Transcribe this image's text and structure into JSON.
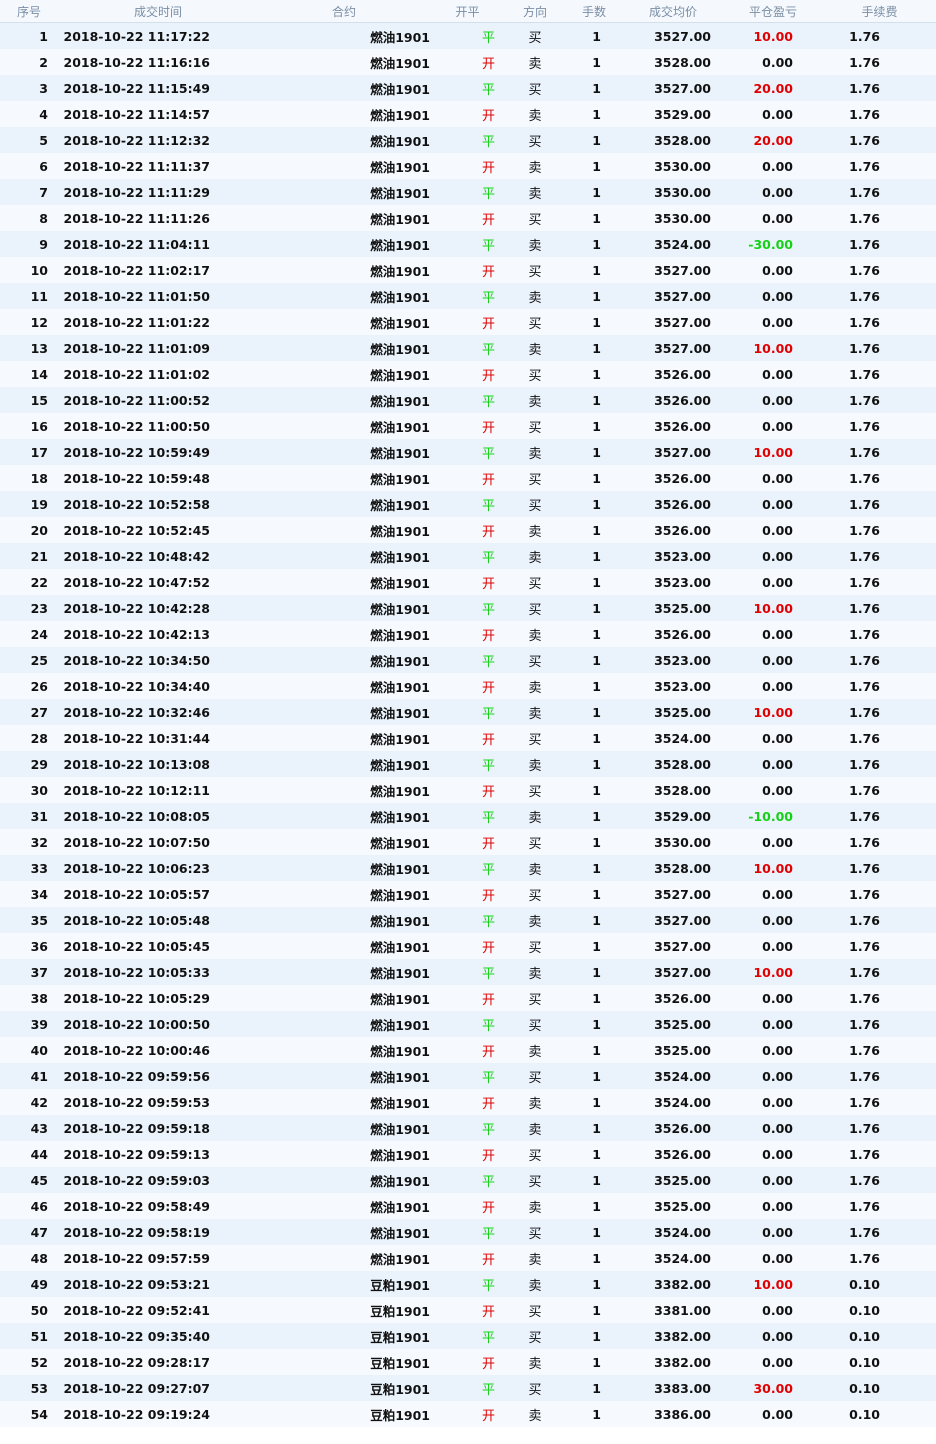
{
  "table": {
    "headers": [
      "序号",
      "成交时间",
      "合约",
      "开平",
      "方向",
      "手数",
      "成交均价",
      "平仓盈亏",
      "手续费"
    ],
    "colors": {
      "open": "#e00000",
      "close": "#16d016",
      "profit": "#e00000",
      "loss": "#16d016"
    },
    "rows": [
      {
        "no": "1",
        "time": "2018-10-22 11:17:22",
        "contract": "燃油1901",
        "oc": "平",
        "dir": "买",
        "lots": "1",
        "price": "3527.00",
        "pnl": "10.00",
        "fee": "1.76"
      },
      {
        "no": "2",
        "time": "2018-10-22 11:16:16",
        "contract": "燃油1901",
        "oc": "开",
        "dir": "卖",
        "lots": "1",
        "price": "3528.00",
        "pnl": "0.00",
        "fee": "1.76"
      },
      {
        "no": "3",
        "time": "2018-10-22 11:15:49",
        "contract": "燃油1901",
        "oc": "平",
        "dir": "买",
        "lots": "1",
        "price": "3527.00",
        "pnl": "20.00",
        "fee": "1.76"
      },
      {
        "no": "4",
        "time": "2018-10-22 11:14:57",
        "contract": "燃油1901",
        "oc": "开",
        "dir": "卖",
        "lots": "1",
        "price": "3529.00",
        "pnl": "0.00",
        "fee": "1.76"
      },
      {
        "no": "5",
        "time": "2018-10-22 11:12:32",
        "contract": "燃油1901",
        "oc": "平",
        "dir": "买",
        "lots": "1",
        "price": "3528.00",
        "pnl": "20.00",
        "fee": "1.76"
      },
      {
        "no": "6",
        "time": "2018-10-22 11:11:37",
        "contract": "燃油1901",
        "oc": "开",
        "dir": "卖",
        "lots": "1",
        "price": "3530.00",
        "pnl": "0.00",
        "fee": "1.76"
      },
      {
        "no": "7",
        "time": "2018-10-22 11:11:29",
        "contract": "燃油1901",
        "oc": "平",
        "dir": "卖",
        "lots": "1",
        "price": "3530.00",
        "pnl": "0.00",
        "fee": "1.76"
      },
      {
        "no": "8",
        "time": "2018-10-22 11:11:26",
        "contract": "燃油1901",
        "oc": "开",
        "dir": "买",
        "lots": "1",
        "price": "3530.00",
        "pnl": "0.00",
        "fee": "1.76"
      },
      {
        "no": "9",
        "time": "2018-10-22 11:04:11",
        "contract": "燃油1901",
        "oc": "平",
        "dir": "卖",
        "lots": "1",
        "price": "3524.00",
        "pnl": "-30.00",
        "fee": "1.76"
      },
      {
        "no": "10",
        "time": "2018-10-22 11:02:17",
        "contract": "燃油1901",
        "oc": "开",
        "dir": "买",
        "lots": "1",
        "price": "3527.00",
        "pnl": "0.00",
        "fee": "1.76"
      },
      {
        "no": "11",
        "time": "2018-10-22 11:01:50",
        "contract": "燃油1901",
        "oc": "平",
        "dir": "卖",
        "lots": "1",
        "price": "3527.00",
        "pnl": "0.00",
        "fee": "1.76"
      },
      {
        "no": "12",
        "time": "2018-10-22 11:01:22",
        "contract": "燃油1901",
        "oc": "开",
        "dir": "买",
        "lots": "1",
        "price": "3527.00",
        "pnl": "0.00",
        "fee": "1.76"
      },
      {
        "no": "13",
        "time": "2018-10-22 11:01:09",
        "contract": "燃油1901",
        "oc": "平",
        "dir": "卖",
        "lots": "1",
        "price": "3527.00",
        "pnl": "10.00",
        "fee": "1.76"
      },
      {
        "no": "14",
        "time": "2018-10-22 11:01:02",
        "contract": "燃油1901",
        "oc": "开",
        "dir": "买",
        "lots": "1",
        "price": "3526.00",
        "pnl": "0.00",
        "fee": "1.76"
      },
      {
        "no": "15",
        "time": "2018-10-22 11:00:52",
        "contract": "燃油1901",
        "oc": "平",
        "dir": "卖",
        "lots": "1",
        "price": "3526.00",
        "pnl": "0.00",
        "fee": "1.76"
      },
      {
        "no": "16",
        "time": "2018-10-22 11:00:50",
        "contract": "燃油1901",
        "oc": "开",
        "dir": "买",
        "lots": "1",
        "price": "3526.00",
        "pnl": "0.00",
        "fee": "1.76"
      },
      {
        "no": "17",
        "time": "2018-10-22 10:59:49",
        "contract": "燃油1901",
        "oc": "平",
        "dir": "卖",
        "lots": "1",
        "price": "3527.00",
        "pnl": "10.00",
        "fee": "1.76"
      },
      {
        "no": "18",
        "time": "2018-10-22 10:59:48",
        "contract": "燃油1901",
        "oc": "开",
        "dir": "买",
        "lots": "1",
        "price": "3526.00",
        "pnl": "0.00",
        "fee": "1.76"
      },
      {
        "no": "19",
        "time": "2018-10-22 10:52:58",
        "contract": "燃油1901",
        "oc": "平",
        "dir": "买",
        "lots": "1",
        "price": "3526.00",
        "pnl": "0.00",
        "fee": "1.76"
      },
      {
        "no": "20",
        "time": "2018-10-22 10:52:45",
        "contract": "燃油1901",
        "oc": "开",
        "dir": "卖",
        "lots": "1",
        "price": "3526.00",
        "pnl": "0.00",
        "fee": "1.76"
      },
      {
        "no": "21",
        "time": "2018-10-22 10:48:42",
        "contract": "燃油1901",
        "oc": "平",
        "dir": "卖",
        "lots": "1",
        "price": "3523.00",
        "pnl": "0.00",
        "fee": "1.76"
      },
      {
        "no": "22",
        "time": "2018-10-22 10:47:52",
        "contract": "燃油1901",
        "oc": "开",
        "dir": "买",
        "lots": "1",
        "price": "3523.00",
        "pnl": "0.00",
        "fee": "1.76"
      },
      {
        "no": "23",
        "time": "2018-10-22 10:42:28",
        "contract": "燃油1901",
        "oc": "平",
        "dir": "买",
        "lots": "1",
        "price": "3525.00",
        "pnl": "10.00",
        "fee": "1.76"
      },
      {
        "no": "24",
        "time": "2018-10-22 10:42:13",
        "contract": "燃油1901",
        "oc": "开",
        "dir": "卖",
        "lots": "1",
        "price": "3526.00",
        "pnl": "0.00",
        "fee": "1.76"
      },
      {
        "no": "25",
        "time": "2018-10-22 10:34:50",
        "contract": "燃油1901",
        "oc": "平",
        "dir": "买",
        "lots": "1",
        "price": "3523.00",
        "pnl": "0.00",
        "fee": "1.76"
      },
      {
        "no": "26",
        "time": "2018-10-22 10:34:40",
        "contract": "燃油1901",
        "oc": "开",
        "dir": "卖",
        "lots": "1",
        "price": "3523.00",
        "pnl": "0.00",
        "fee": "1.76"
      },
      {
        "no": "27",
        "time": "2018-10-22 10:32:46",
        "contract": "燃油1901",
        "oc": "平",
        "dir": "卖",
        "lots": "1",
        "price": "3525.00",
        "pnl": "10.00",
        "fee": "1.76"
      },
      {
        "no": "28",
        "time": "2018-10-22 10:31:44",
        "contract": "燃油1901",
        "oc": "开",
        "dir": "买",
        "lots": "1",
        "price": "3524.00",
        "pnl": "0.00",
        "fee": "1.76"
      },
      {
        "no": "29",
        "time": "2018-10-22 10:13:08",
        "contract": "燃油1901",
        "oc": "平",
        "dir": "卖",
        "lots": "1",
        "price": "3528.00",
        "pnl": "0.00",
        "fee": "1.76"
      },
      {
        "no": "30",
        "time": "2018-10-22 10:12:11",
        "contract": "燃油1901",
        "oc": "开",
        "dir": "买",
        "lots": "1",
        "price": "3528.00",
        "pnl": "0.00",
        "fee": "1.76"
      },
      {
        "no": "31",
        "time": "2018-10-22 10:08:05",
        "contract": "燃油1901",
        "oc": "平",
        "dir": "卖",
        "lots": "1",
        "price": "3529.00",
        "pnl": "-10.00",
        "fee": "1.76"
      },
      {
        "no": "32",
        "time": "2018-10-22 10:07:50",
        "contract": "燃油1901",
        "oc": "开",
        "dir": "买",
        "lots": "1",
        "price": "3530.00",
        "pnl": "0.00",
        "fee": "1.76"
      },
      {
        "no": "33",
        "time": "2018-10-22 10:06:23",
        "contract": "燃油1901",
        "oc": "平",
        "dir": "卖",
        "lots": "1",
        "price": "3528.00",
        "pnl": "10.00",
        "fee": "1.76"
      },
      {
        "no": "34",
        "time": "2018-10-22 10:05:57",
        "contract": "燃油1901",
        "oc": "开",
        "dir": "买",
        "lots": "1",
        "price": "3527.00",
        "pnl": "0.00",
        "fee": "1.76"
      },
      {
        "no": "35",
        "time": "2018-10-22 10:05:48",
        "contract": "燃油1901",
        "oc": "平",
        "dir": "卖",
        "lots": "1",
        "price": "3527.00",
        "pnl": "0.00",
        "fee": "1.76"
      },
      {
        "no": "36",
        "time": "2018-10-22 10:05:45",
        "contract": "燃油1901",
        "oc": "开",
        "dir": "买",
        "lots": "1",
        "price": "3527.00",
        "pnl": "0.00",
        "fee": "1.76"
      },
      {
        "no": "37",
        "time": "2018-10-22 10:05:33",
        "contract": "燃油1901",
        "oc": "平",
        "dir": "卖",
        "lots": "1",
        "price": "3527.00",
        "pnl": "10.00",
        "fee": "1.76"
      },
      {
        "no": "38",
        "time": "2018-10-22 10:05:29",
        "contract": "燃油1901",
        "oc": "开",
        "dir": "买",
        "lots": "1",
        "price": "3526.00",
        "pnl": "0.00",
        "fee": "1.76"
      },
      {
        "no": "39",
        "time": "2018-10-22 10:00:50",
        "contract": "燃油1901",
        "oc": "平",
        "dir": "买",
        "lots": "1",
        "price": "3525.00",
        "pnl": "0.00",
        "fee": "1.76"
      },
      {
        "no": "40",
        "time": "2018-10-22 10:00:46",
        "contract": "燃油1901",
        "oc": "开",
        "dir": "卖",
        "lots": "1",
        "price": "3525.00",
        "pnl": "0.00",
        "fee": "1.76"
      },
      {
        "no": "41",
        "time": "2018-10-22 09:59:56",
        "contract": "燃油1901",
        "oc": "平",
        "dir": "买",
        "lots": "1",
        "price": "3524.00",
        "pnl": "0.00",
        "fee": "1.76"
      },
      {
        "no": "42",
        "time": "2018-10-22 09:59:53",
        "contract": "燃油1901",
        "oc": "开",
        "dir": "卖",
        "lots": "1",
        "price": "3524.00",
        "pnl": "0.00",
        "fee": "1.76"
      },
      {
        "no": "43",
        "time": "2018-10-22 09:59:18",
        "contract": "燃油1901",
        "oc": "平",
        "dir": "卖",
        "lots": "1",
        "price": "3526.00",
        "pnl": "0.00",
        "fee": "1.76"
      },
      {
        "no": "44",
        "time": "2018-10-22 09:59:13",
        "contract": "燃油1901",
        "oc": "开",
        "dir": "买",
        "lots": "1",
        "price": "3526.00",
        "pnl": "0.00",
        "fee": "1.76"
      },
      {
        "no": "45",
        "time": "2018-10-22 09:59:03",
        "contract": "燃油1901",
        "oc": "平",
        "dir": "买",
        "lots": "1",
        "price": "3525.00",
        "pnl": "0.00",
        "fee": "1.76"
      },
      {
        "no": "46",
        "time": "2018-10-22 09:58:49",
        "contract": "燃油1901",
        "oc": "开",
        "dir": "卖",
        "lots": "1",
        "price": "3525.00",
        "pnl": "0.00",
        "fee": "1.76"
      },
      {
        "no": "47",
        "time": "2018-10-22 09:58:19",
        "contract": "燃油1901",
        "oc": "平",
        "dir": "买",
        "lots": "1",
        "price": "3524.00",
        "pnl": "0.00",
        "fee": "1.76"
      },
      {
        "no": "48",
        "time": "2018-10-22 09:57:59",
        "contract": "燃油1901",
        "oc": "开",
        "dir": "卖",
        "lots": "1",
        "price": "3524.00",
        "pnl": "0.00",
        "fee": "1.76"
      },
      {
        "no": "49",
        "time": "2018-10-22 09:53:21",
        "contract": "豆粕1901",
        "oc": "平",
        "dir": "卖",
        "lots": "1",
        "price": "3382.00",
        "pnl": "10.00",
        "fee": "0.10"
      },
      {
        "no": "50",
        "time": "2018-10-22 09:52:41",
        "contract": "豆粕1901",
        "oc": "开",
        "dir": "买",
        "lots": "1",
        "price": "3381.00",
        "pnl": "0.00",
        "fee": "0.10"
      },
      {
        "no": "51",
        "time": "2018-10-22 09:35:40",
        "contract": "豆粕1901",
        "oc": "平",
        "dir": "买",
        "lots": "1",
        "price": "3382.00",
        "pnl": "0.00",
        "fee": "0.10"
      },
      {
        "no": "52",
        "time": "2018-10-22 09:28:17",
        "contract": "豆粕1901",
        "oc": "开",
        "dir": "卖",
        "lots": "1",
        "price": "3382.00",
        "pnl": "0.00",
        "fee": "0.10"
      },
      {
        "no": "53",
        "time": "2018-10-22 09:27:07",
        "contract": "豆粕1901",
        "oc": "平",
        "dir": "买",
        "lots": "1",
        "price": "3383.00",
        "pnl": "30.00",
        "fee": "0.10"
      },
      {
        "no": "54",
        "time": "2018-10-22 09:19:24",
        "contract": "豆粕1901",
        "oc": "开",
        "dir": "卖",
        "lots": "1",
        "price": "3386.00",
        "pnl": "0.00",
        "fee": "0.10"
      }
    ]
  }
}
